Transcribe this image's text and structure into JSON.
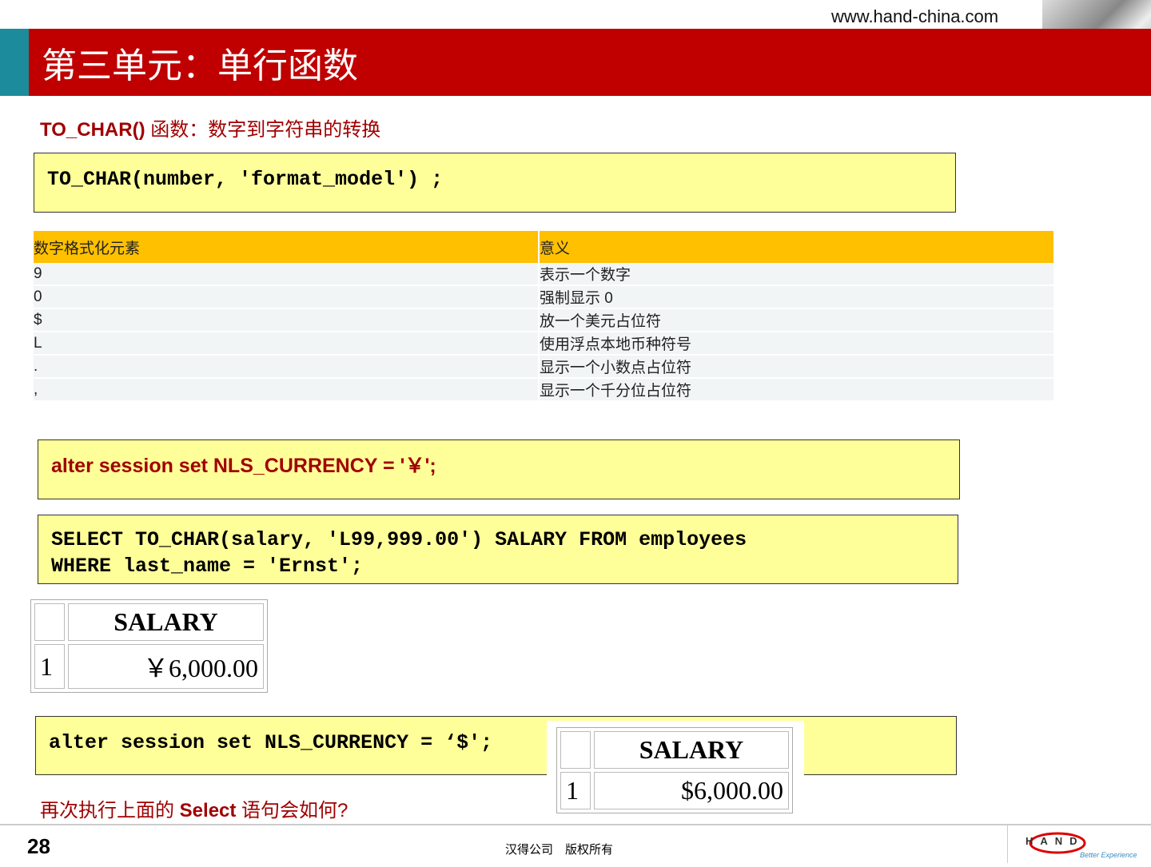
{
  "header": {
    "url": "www.hand-china.com",
    "title": "第三单元：单行函数"
  },
  "subtitle": {
    "func": "TO_CHAR()",
    "desc": " 函数：数字到字符串的转换"
  },
  "syntax": "TO_CHAR(number, 'format_model') ;",
  "format_table": {
    "headers": [
      "数字格式化元素",
      "意义"
    ],
    "rows": [
      [
        "9",
        "表示一个数字"
      ],
      [
        "0",
        "强制显示 0"
      ],
      [
        "$",
        "放一个美元占位符"
      ],
      [
        "L",
        "使用浮点本地币种符号"
      ],
      [
        ".",
        "显示一个小数点占位符"
      ],
      [
        ",",
        "显示一个千分位占位符"
      ]
    ]
  },
  "alter1": "alter session set NLS_CURRENCY = '￥';",
  "select": {
    "line1": "SELECT TO_CHAR(salary, 'L99,999.00') SALARY FROM employees",
    "line2": "WHERE last_name = 'Ernst';"
  },
  "result1": {
    "header": "SALARY",
    "row": "1",
    "value": "￥6,000.00"
  },
  "alter2": "alter session set NLS_CURRENCY = ‘$';",
  "result2": {
    "header": "SALARY",
    "row": "1",
    "value": "$6,000.00"
  },
  "question": {
    "pre": "再次执行上面的 ",
    "kw": "Select",
    "post": "  语句会如何?"
  },
  "footer": {
    "page": "28",
    "copyright": "汉得公司　版权所有",
    "logo_text": "HAND",
    "logo_tagline": "Better Experience"
  },
  "colors": {
    "brand_red": "#c00000",
    "teal": "#1c8c9c",
    "table_header": "#ffc000",
    "code_bg": "#ffff99"
  }
}
